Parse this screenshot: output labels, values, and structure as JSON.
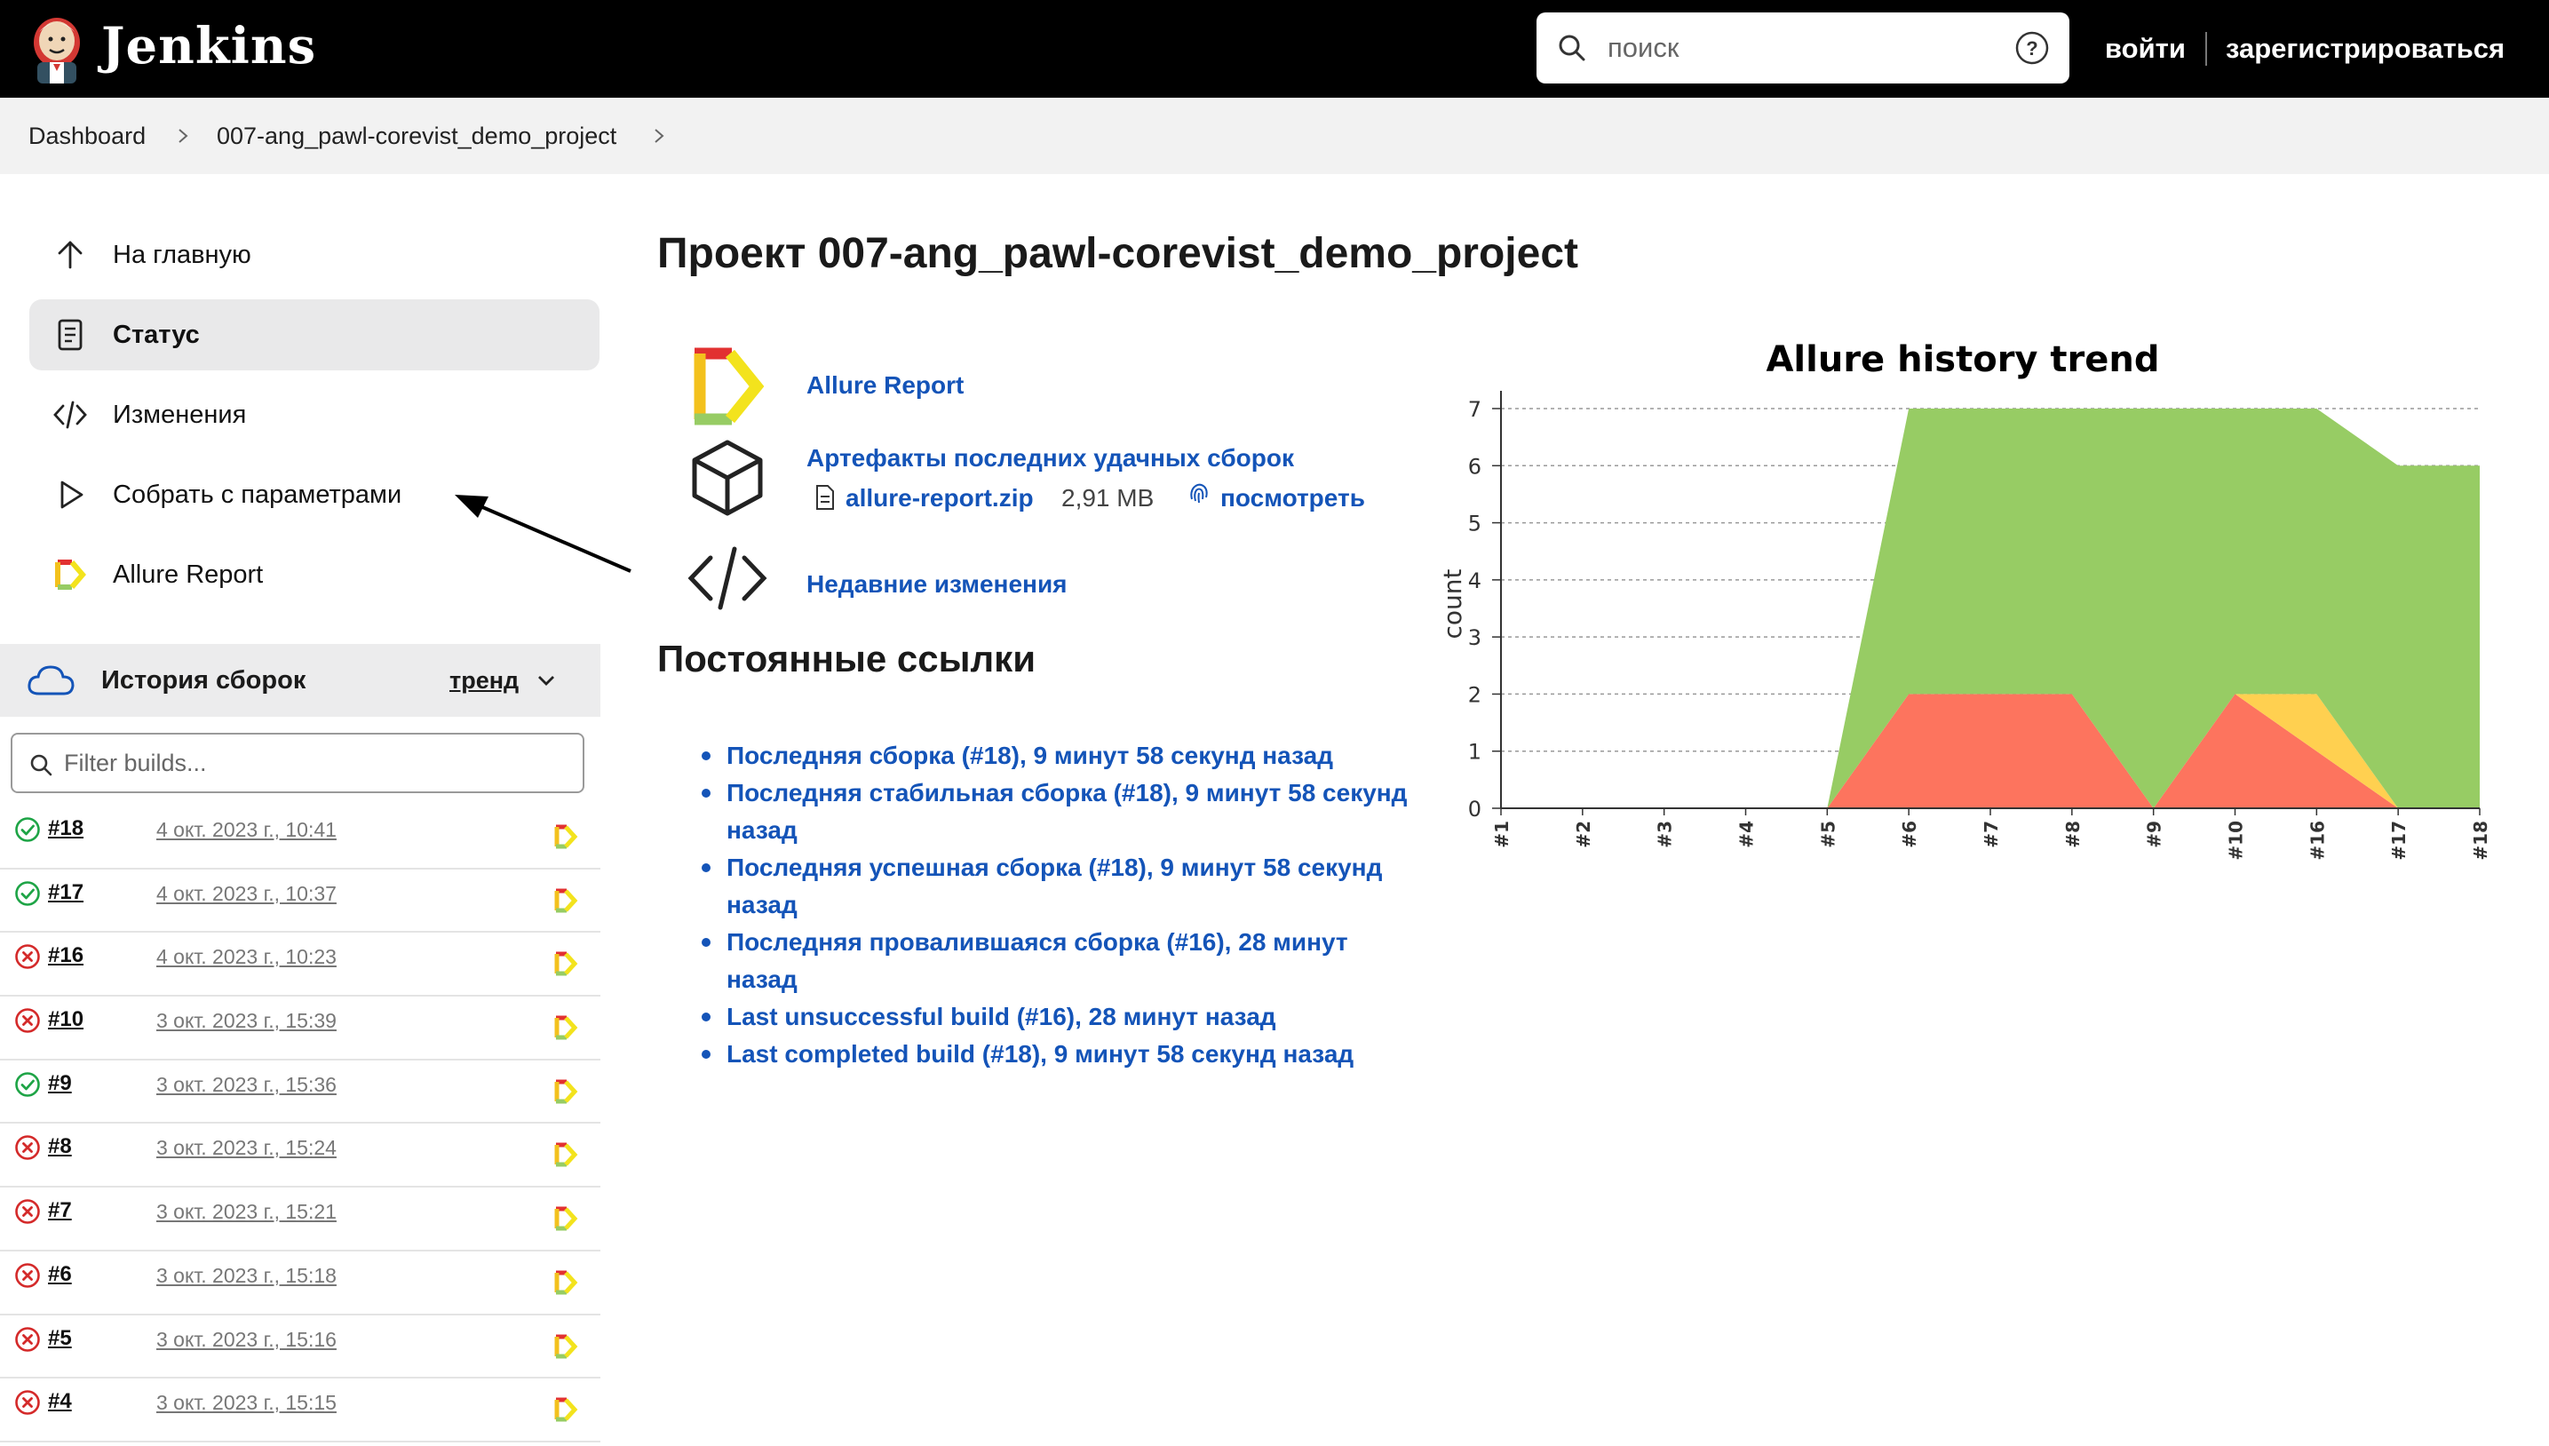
{
  "header": {
    "brand": "Jenkins",
    "search_placeholder": "поиск",
    "login": "войти",
    "register": "зарегистрироваться"
  },
  "breadcrumb": [
    "Dashboard",
    "007-ang_pawl-corevist_demo_project"
  ],
  "sidebar": {
    "items": [
      {
        "label": "На главную",
        "icon": "arrow-up-icon"
      },
      {
        "label": "Статус",
        "icon": "document-icon",
        "active": true
      },
      {
        "label": "Изменения",
        "icon": "code-icon"
      },
      {
        "label": "Собрать с параметрами",
        "icon": "play-icon"
      },
      {
        "label": "Allure Report",
        "icon": "allure-icon"
      }
    ]
  },
  "history": {
    "title": "История сборок",
    "trend": "тренд",
    "filter_placeholder": "Filter builds...",
    "builds": [
      {
        "num": "#18",
        "date": "4 окт. 2023 г., 10:41",
        "status": "success"
      },
      {
        "num": "#17",
        "date": "4 окт. 2023 г., 10:37",
        "status": "success"
      },
      {
        "num": "#16",
        "date": "4 окт. 2023 г., 10:23",
        "status": "failed"
      },
      {
        "num": "#10",
        "date": "3 окт. 2023 г., 15:39",
        "status": "failed"
      },
      {
        "num": "#9",
        "date": "3 окт. 2023 г., 15:36",
        "status": "success"
      },
      {
        "num": "#8",
        "date": "3 окт. 2023 г., 15:24",
        "status": "failed"
      },
      {
        "num": "#7",
        "date": "3 окт. 2023 г., 15:21",
        "status": "failed"
      },
      {
        "num": "#6",
        "date": "3 окт. 2023 г., 15:18",
        "status": "failed"
      },
      {
        "num": "#5",
        "date": "3 окт. 2023 г., 15:16",
        "status": "failed"
      },
      {
        "num": "#4",
        "date": "3 окт. 2023 г., 15:15",
        "status": "failed"
      }
    ]
  },
  "main": {
    "title": "Проект 007-ang_pawl-corevist_demo_project",
    "allure_link": "Allure Report",
    "artifacts_title": "Артефакты последних удачных сборок",
    "artifact_file": "allure-report.zip",
    "artifact_size": "2,91 MB",
    "artifact_view": "посмотреть",
    "recent_changes": "Недавние изменения",
    "permalinks_title": "Постоянные ссылки",
    "permalinks": [
      "Последняя сборка (#18), 9 минут 58 секунд назад",
      "Последняя стабильная сборка (#18), 9 минут 58 секунд назад",
      "Последняя успешная сборка (#18), 9 минут 58 секунд назад",
      "Последняя провалившаяся сборка (#16), 28 минут назад",
      "Last unsuccessful build (#16), 28 минут назад",
      "Last completed build (#18), 9 минут 58 секунд назад"
    ]
  },
  "colors": {
    "passed": "#97cc64",
    "failed": "#fd745e",
    "broken": "#ffd050",
    "link": "#1454b8",
    "success_icon": "#1ea446",
    "failed_icon": "#d42a2a"
  },
  "chart_data": {
    "type": "area",
    "title": "Allure history trend",
    "ylabel": "count",
    "xlabel": "",
    "categories": [
      "#1",
      "#2",
      "#3",
      "#4",
      "#5",
      "#6",
      "#7",
      "#8",
      "#9",
      "#10",
      "#16",
      "#17",
      "#18"
    ],
    "ylim": [
      0,
      7
    ],
    "yticks": [
      0,
      1,
      2,
      3,
      4,
      5,
      6,
      7
    ],
    "grid": true,
    "series": [
      {
        "key": "failed",
        "values": [
          0,
          0,
          0,
          0,
          0,
          2,
          2,
          2,
          0,
          2,
          1,
          0,
          0
        ]
      },
      {
        "key": "broken",
        "values": [
          0,
          0,
          0,
          0,
          0,
          0,
          0,
          0,
          0,
          0,
          1,
          0,
          0
        ]
      },
      {
        "key": "passed",
        "values": [
          0,
          0,
          0,
          0,
          0,
          5,
          5,
          5,
          7,
          5,
          5,
          6,
          6
        ]
      }
    ]
  }
}
